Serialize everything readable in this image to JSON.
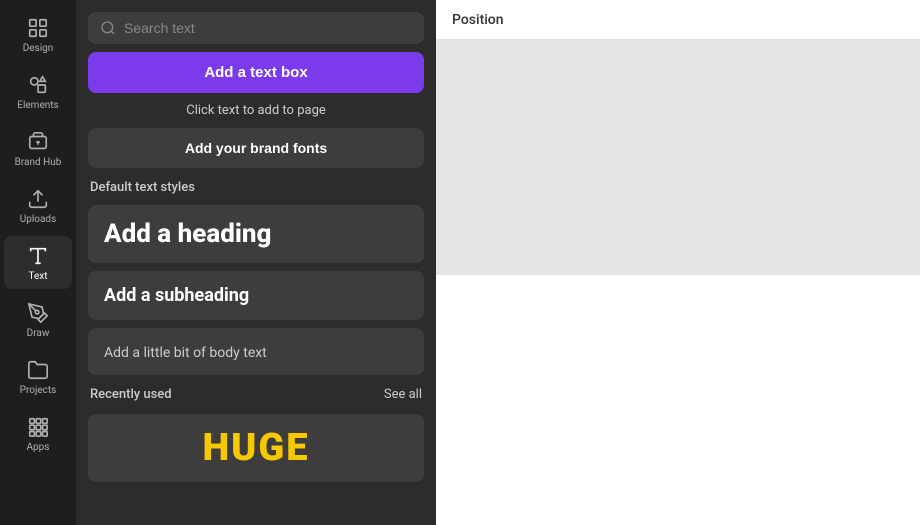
{
  "sidebar": {
    "items": [
      {
        "id": "design",
        "label": "Design",
        "icon": "design"
      },
      {
        "id": "elements",
        "label": "Elements",
        "icon": "elements"
      },
      {
        "id": "brand-hub",
        "label": "Brand Hub",
        "icon": "brand-hub"
      },
      {
        "id": "uploads",
        "label": "Uploads",
        "icon": "uploads"
      },
      {
        "id": "text",
        "label": "Text",
        "icon": "text",
        "active": true
      },
      {
        "id": "draw",
        "label": "Draw",
        "icon": "draw"
      },
      {
        "id": "projects",
        "label": "Projects",
        "icon": "projects"
      },
      {
        "id": "apps",
        "label": "Apps",
        "icon": "apps"
      }
    ]
  },
  "panel": {
    "search_placeholder": "Search text",
    "add_text_box_label": "Add a text box",
    "click_text_label": "Click text to add to page",
    "brand_fonts_label": "Add your brand fonts",
    "default_text_styles_label": "Default text styles",
    "heading_label": "Add a heading",
    "subheading_label": "Add a subheading",
    "body_label": "Add a little bit of body text",
    "recently_used_label": "Recently used",
    "see_all_label": "See all",
    "huge_text": "HUGE"
  },
  "canvas": {
    "position_label": "Position"
  }
}
